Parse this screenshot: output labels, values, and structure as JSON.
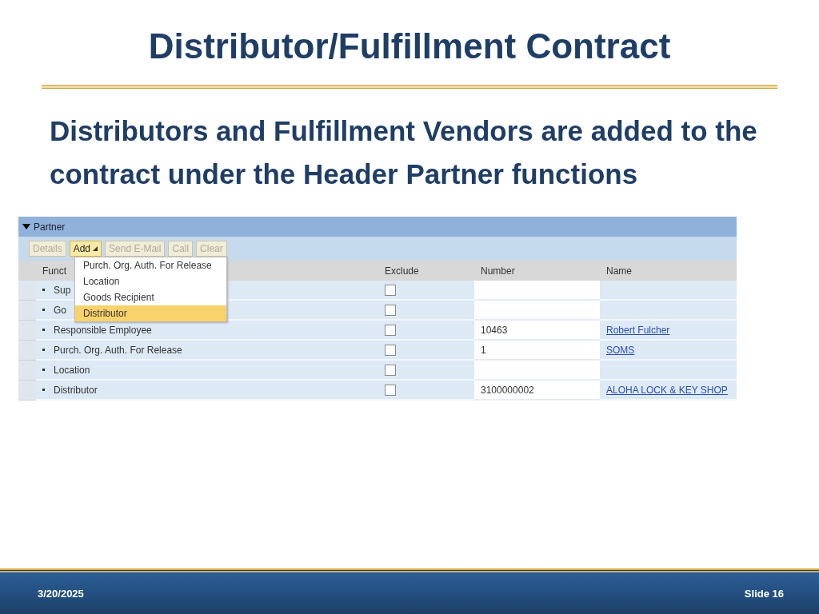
{
  "slide": {
    "title": "Distributor/Fulfillment Contract",
    "body": "Distributors and Fulfillment Vendors are added to the contract under the Header Partner functions"
  },
  "partner_panel": {
    "title": "Partner",
    "expanded": true,
    "toolbar": [
      {
        "label": "Details",
        "disabled": true,
        "menu": false
      },
      {
        "label": "Add",
        "disabled": false,
        "menu": true
      },
      {
        "label": "Send E-Mail",
        "disabled": true,
        "menu": false
      },
      {
        "label": "Call",
        "disabled": true,
        "menu": false
      },
      {
        "label": "Clear",
        "disabled": true,
        "menu": false
      }
    ],
    "add_menu": [
      {
        "label": "Purch. Org. Auth. For Release",
        "selected": false
      },
      {
        "label": "Location",
        "selected": false
      },
      {
        "label": "Goods Recipient",
        "selected": false
      },
      {
        "label": "Distributor",
        "selected": true
      }
    ],
    "columns": [
      "Funct",
      "Exclude",
      "Number",
      "Name"
    ],
    "rows": [
      {
        "function": "Sup",
        "exclude": false,
        "number": "",
        "name": ""
      },
      {
        "function": "Go",
        "exclude": false,
        "number": "",
        "name": ""
      },
      {
        "function": "Responsible Employee",
        "exclude": false,
        "number": "10463",
        "name": "Robert Fulcher"
      },
      {
        "function": "Purch. Org. Auth. For Release",
        "exclude": false,
        "number": "1",
        "name": "SOMS"
      },
      {
        "function": "Location",
        "exclude": false,
        "number": "",
        "name": ""
      },
      {
        "function": "Distributor",
        "exclude": false,
        "number": "3100000002",
        "name": "ALOHA LOCK & KEY SHOP"
      }
    ]
  },
  "footer": {
    "date": "3/20/2025",
    "slide_number": "Slide 16"
  }
}
